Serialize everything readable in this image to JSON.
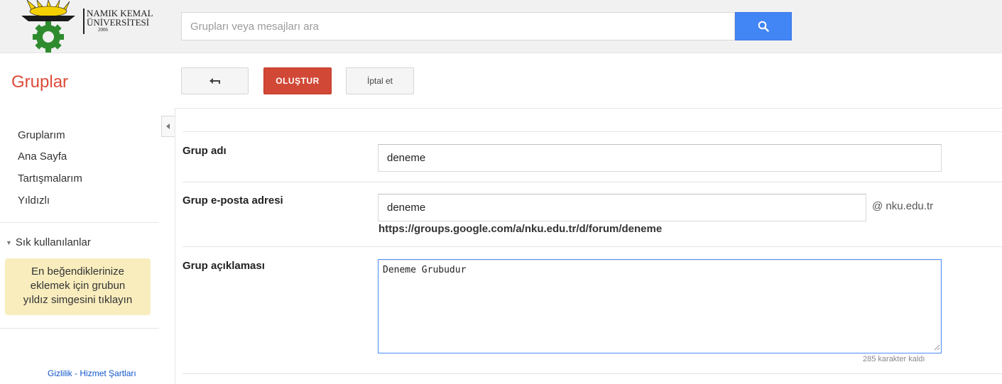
{
  "header": {
    "logo": {
      "line1": "NAMIK KEMAL",
      "line2": "ÜNİVERSİTESİ",
      "year": "2006"
    },
    "search": {
      "placeholder": "Grupları veya mesajları ara",
      "value": "",
      "icon": "search-icon"
    }
  },
  "toolbar": {
    "app_title": "Gruplar",
    "back_icon": "back-arrow-icon",
    "create_label": "OLUŞTUR",
    "cancel_label": "İptal et"
  },
  "sidebar": {
    "collapse_icon": "chevron-left-icon",
    "items": [
      {
        "label": "Gruplarım"
      },
      {
        "label": "Ana Sayfa"
      },
      {
        "label": "Tartışmalarım"
      },
      {
        "label": "Yıldızlı"
      }
    ],
    "favorites": {
      "header": "Sık kullanılanlar",
      "hint_line1": "En beğendiklerinize",
      "hint_line2": "eklemek için grubun",
      "hint_line3": "yıldız simgesini tıklayın"
    },
    "footer": {
      "privacy": "Gizlilik",
      "separator": "-",
      "terms": "Hizmet Şartları"
    }
  },
  "form": {
    "name": {
      "label": "Grup adı",
      "value": "deneme"
    },
    "email": {
      "label": "Grup e-posta adresi",
      "value": "deneme",
      "domain": "@ nku.edu.tr",
      "url": "https://groups.google.com/a/nku.edu.tr/d/forum/deneme"
    },
    "description": {
      "label": "Grup açıklaması",
      "value": "Deneme Grubudur",
      "remaining": "285 karakter kaldı"
    }
  },
  "colors": {
    "brand_red": "#dd4b39",
    "create_button": "#d14836",
    "search_button": "#4285f4",
    "favorites_bg": "#f9edbe",
    "link": "#1155cc"
  }
}
